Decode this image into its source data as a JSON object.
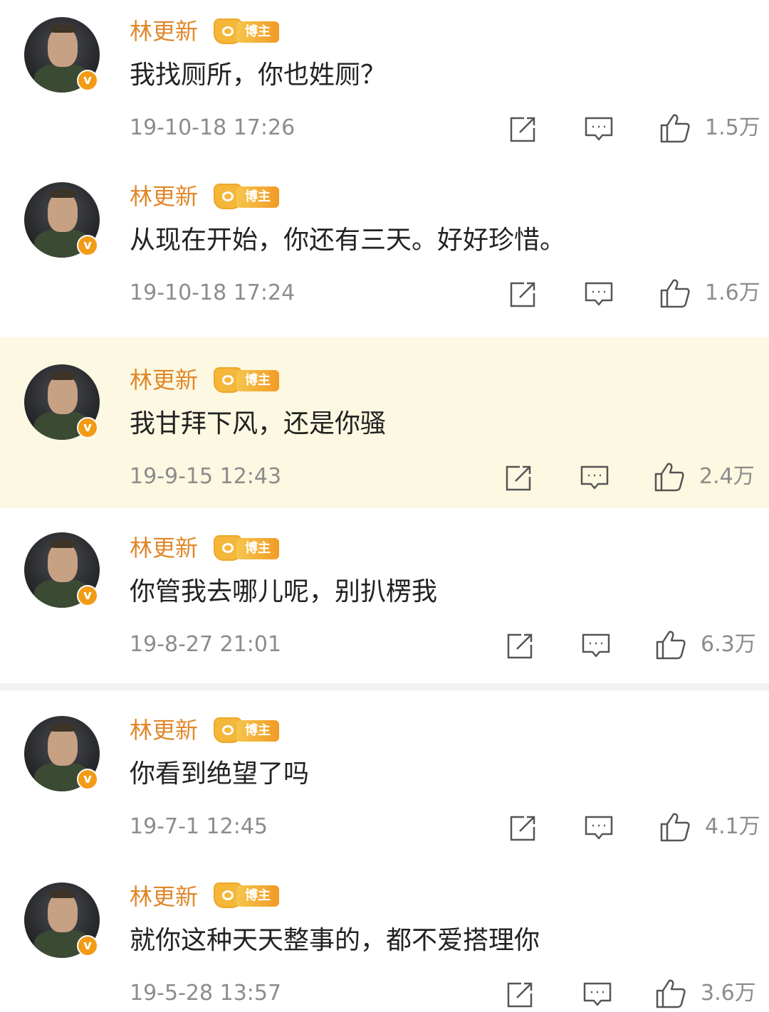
{
  "colors": {
    "username": "#e0872a",
    "highlight_bg": "#fcf8e1",
    "verified_badge": "#f29b16",
    "meta_text": "#8c8c8c"
  },
  "icons": [
    "share-icon",
    "comment-icon",
    "like-icon",
    "verified-badge",
    "blogger-crown-icon"
  ],
  "comments": [
    {
      "username": "林更新",
      "tag": "博主",
      "verified": "v",
      "text": "我找厕所，你也姓厕？",
      "time": "19-10-18 17:26",
      "likes": "1.5万"
    },
    {
      "username": "林更新",
      "tag": "博主",
      "verified": "v",
      "text": "从现在开始，你还有三天。好好珍惜。",
      "time": "19-10-18 17:24",
      "likes": "1.6万"
    },
    {
      "username": "林更新",
      "tag": "博主",
      "verified": "v",
      "text": "我甘拜下风，还是你骚",
      "time": "19-9-15 12:43",
      "likes": "2.4万"
    },
    {
      "username": "林更新",
      "tag": "博主",
      "verified": "v",
      "text": "你管我去哪儿呢，别扒楞我",
      "time": "19-8-27 21:01",
      "likes": "6.3万"
    },
    {
      "username": "林更新",
      "tag": "博主",
      "verified": "v",
      "text": "你看到绝望了吗",
      "time": "19-7-1 12:45",
      "likes": "4.1万"
    },
    {
      "username": "林更新",
      "tag": "博主",
      "verified": "v",
      "text": "就你这种天天整事的，都不爱搭理你",
      "time": "19-5-28 13:57",
      "likes": "3.6万"
    }
  ]
}
